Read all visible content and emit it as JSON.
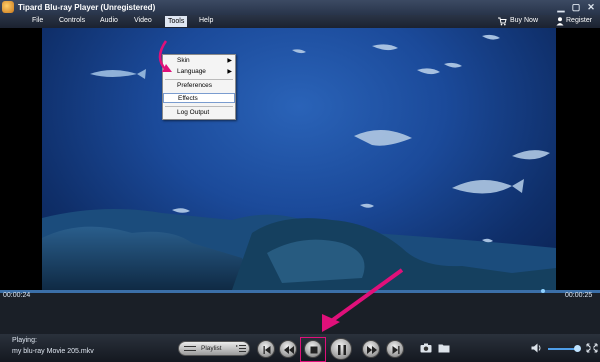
{
  "window": {
    "title": "Tipard Blu-ray Player (Unregistered)"
  },
  "menubar": {
    "items": [
      "File",
      "Controls",
      "Audio",
      "Video",
      "Tools",
      "Help"
    ],
    "buy_label": "Buy Now",
    "register_label": "Register"
  },
  "tools_menu": {
    "items": [
      {
        "label": "Skin",
        "submenu": true
      },
      {
        "label": "Language",
        "submenu": true
      },
      {
        "label": "Preferences",
        "submenu": false
      },
      {
        "label": "Effects",
        "submenu": false
      },
      {
        "label": "Log Output",
        "submenu": false
      }
    ]
  },
  "player": {
    "elapsed": "00:00:24",
    "duration": "00:00:25",
    "progress": 0.96,
    "volume": 0.8,
    "playing_label": "Playing:",
    "file_name": "my blu-ray Movie 205.mkv",
    "playlist_label": "Playlist"
  },
  "colors": {
    "accent": "#e0107a",
    "seek": "#3b6fa8"
  }
}
